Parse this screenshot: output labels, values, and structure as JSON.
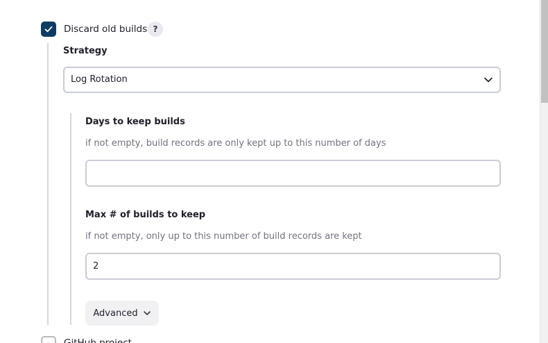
{
  "discard_old_builds": {
    "label": "Discard old builds",
    "checked": true,
    "help_glyph": "?"
  },
  "strategy": {
    "label": "Strategy",
    "selected": "Log Rotation"
  },
  "days_to_keep": {
    "label": "Days to keep builds",
    "description": "if not empty, build records are only kept up to this number of days",
    "value": ""
  },
  "max_builds": {
    "label": "Max # of builds to keep",
    "description": "if not empty, only up to this number of build records are kept",
    "value": "2"
  },
  "advanced_button": {
    "label": "Advanced"
  },
  "github_project": {
    "label": "GitHub project",
    "checked": false
  },
  "colors": {
    "checkbox_checked": "#0f3c64",
    "field_border": "#c9ccd4",
    "description_text": "#72727e"
  },
  "icons": [
    "check-icon",
    "help-icon",
    "chevron-down-icon"
  ]
}
